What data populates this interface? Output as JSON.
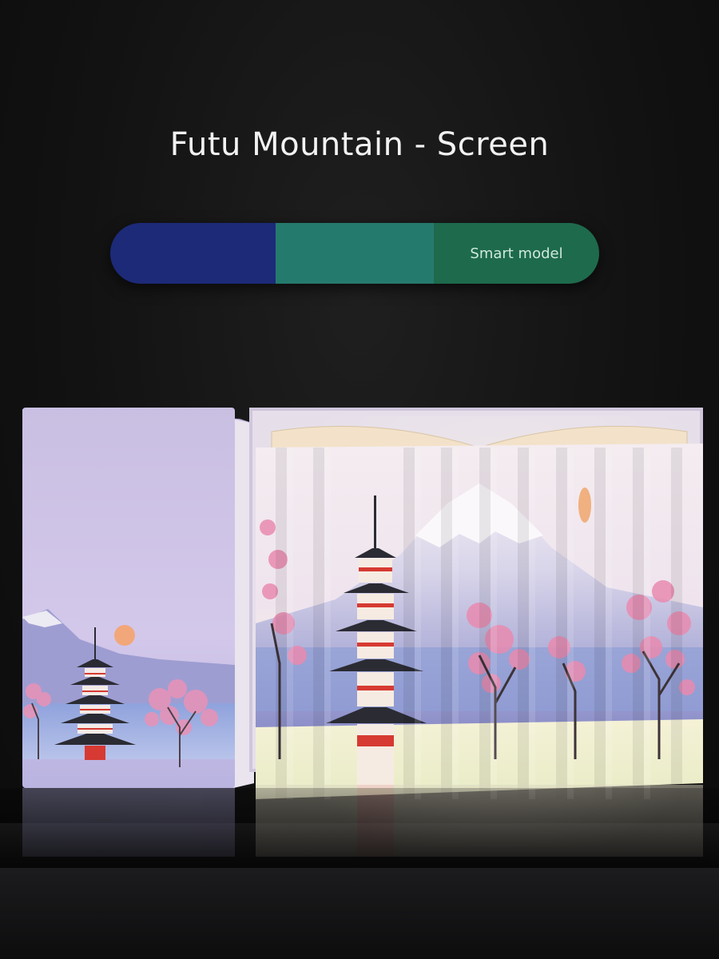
{
  "title": "Futu Mountain - Screen",
  "mode_bar": {
    "segments": [
      {
        "color": "#1c2a78",
        "label": ""
      },
      {
        "color": "#257a6e",
        "label": ""
      },
      {
        "color": "#1e6a4d",
        "label": "Smart model"
      }
    ]
  },
  "colors": {
    "background": "#121212",
    "cover_lavender": "#cbbfe3",
    "cherry_blossom": "#e98bb0",
    "pagoda_red": "#d63a32",
    "sun": "#f2a77a"
  }
}
